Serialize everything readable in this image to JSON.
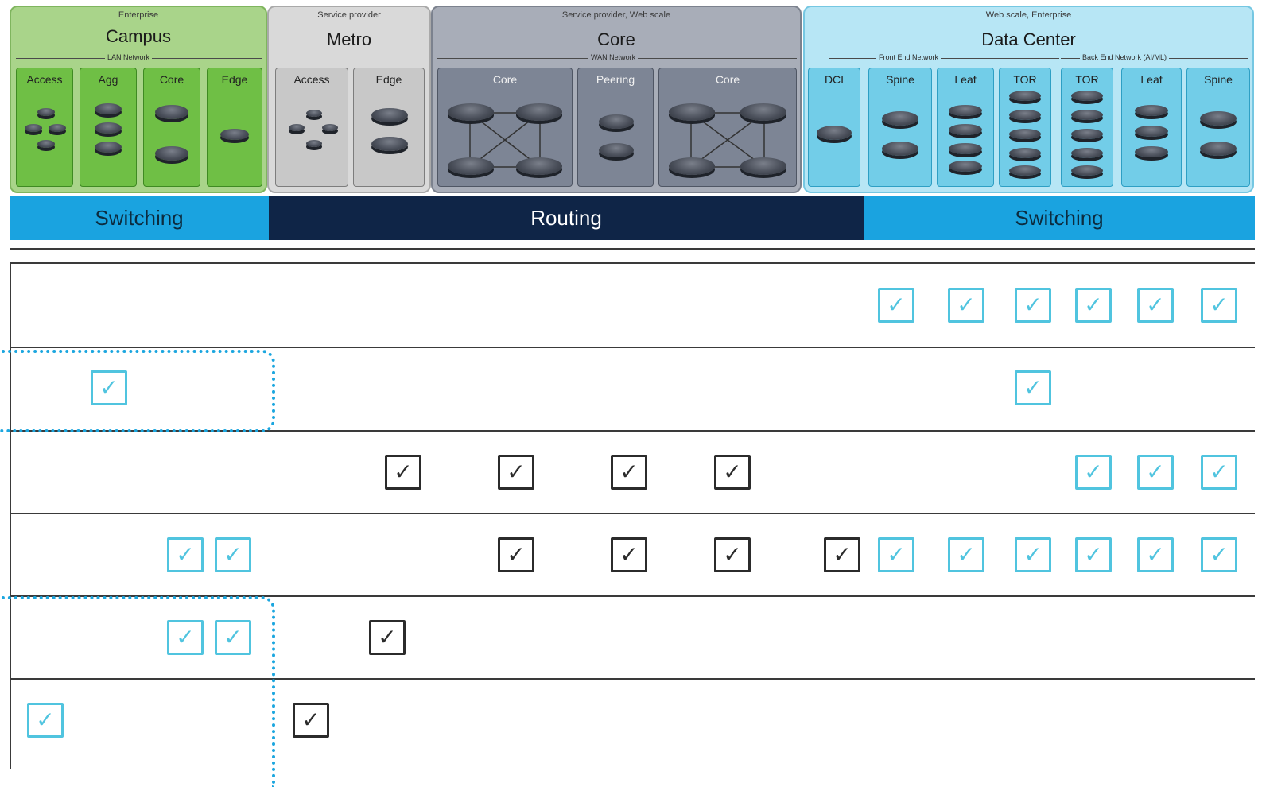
{
  "colors": {
    "campus": "#6fbf45",
    "metro": "#c8c8c8",
    "core": "#7d8595",
    "datacenter": "#72cde8",
    "switching_band": "#1aa3e0",
    "routing_band": "#0f2547",
    "checkbox_teal": "#50c4df",
    "checkbox_dark": "#2b2b2b",
    "dotted_highlight": "#1ba6df"
  },
  "groups": {
    "campus": {
      "subtitle": "Enterprise",
      "title": "Campus",
      "network_label": "LAN Network"
    },
    "metro": {
      "subtitle": "Service provider",
      "title": "Metro"
    },
    "core": {
      "subtitle": "Service provider, Web scale",
      "title": "Core",
      "network_label": "WAN Network"
    },
    "datacenter": {
      "subtitle": "Web scale, Enterprise",
      "title": "Data Center",
      "front_label": "Front End Network",
      "back_label": "Back End Network (AI/ML)"
    }
  },
  "columns": {
    "campus": [
      "Access",
      "Agg",
      "Core",
      "Edge"
    ],
    "metro": [
      "Access",
      "Edge"
    ],
    "core": [
      "Core",
      "Peering",
      "Core"
    ],
    "datacenter": [
      "DCI",
      "Spine",
      "Leaf",
      "TOR",
      "TOR",
      "Leaf",
      "Spine"
    ]
  },
  "bands": {
    "left": "Switching",
    "middle": "Routing",
    "right": "Switching"
  },
  "check_glyph": "✓",
  "icons": {
    "checkbox": "checkbox-icon",
    "router": "router-icon"
  }
}
